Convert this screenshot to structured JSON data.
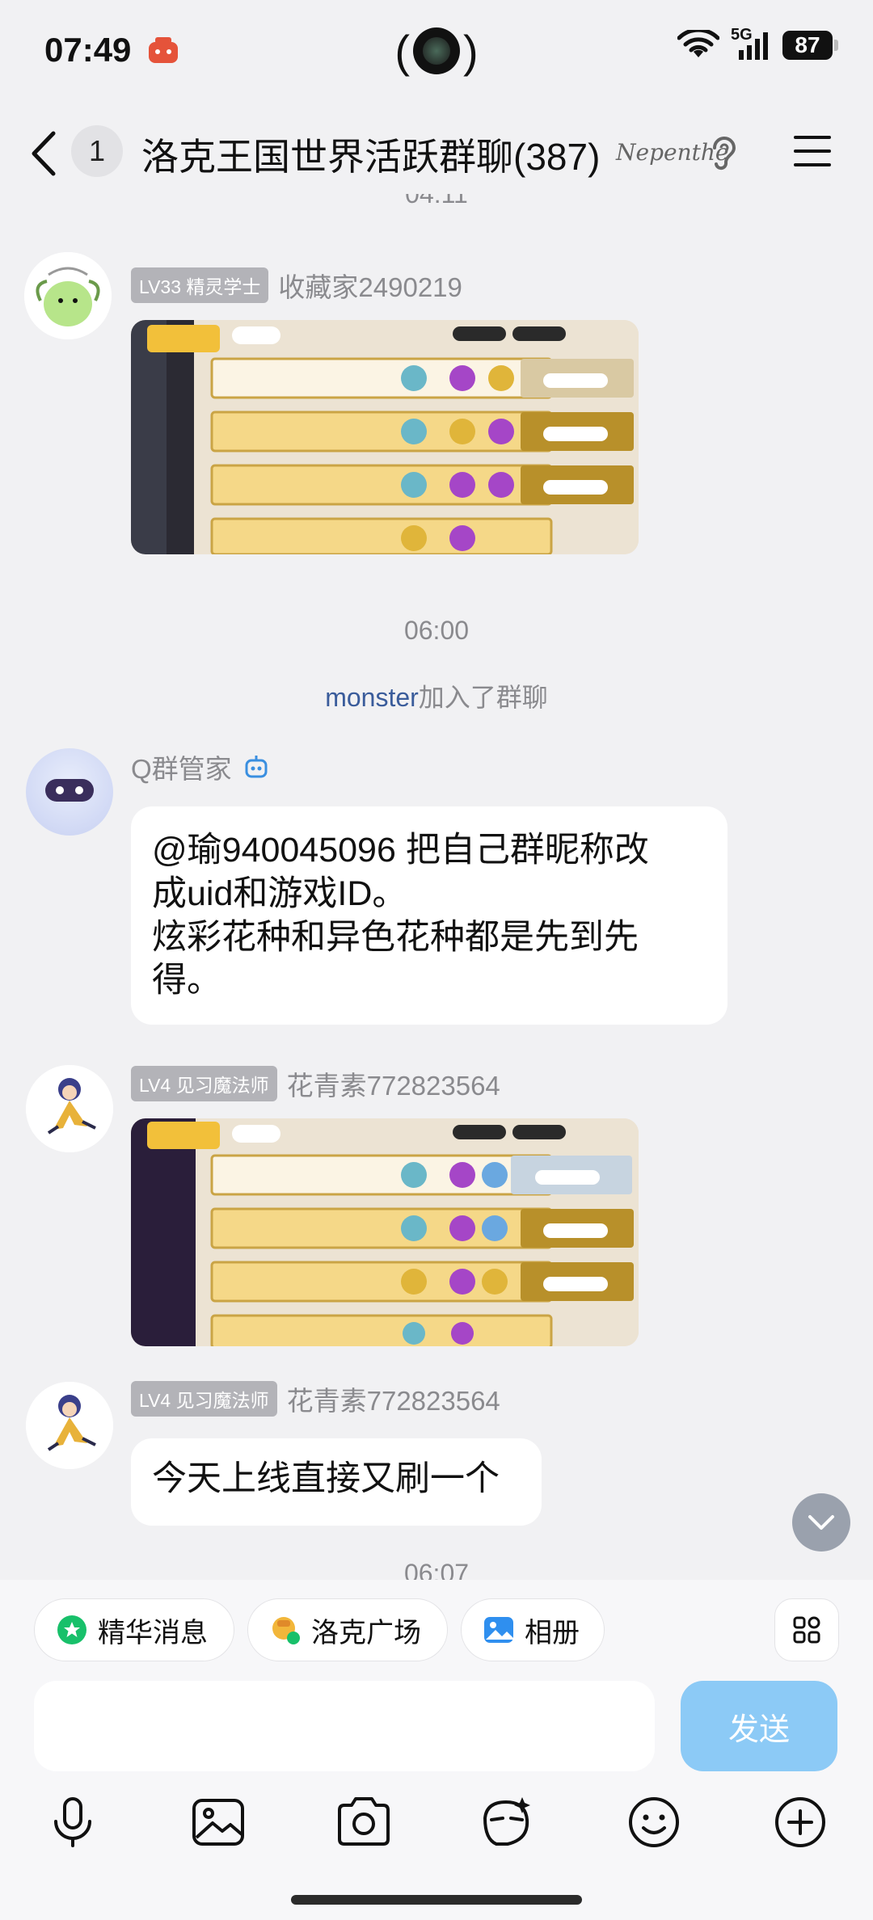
{
  "status_bar": {
    "time": "07:49",
    "battery": "87",
    "network": "5G"
  },
  "header": {
    "unread_count": "1",
    "title": "洛克王国世界活跃群聊(387)",
    "badge_text": "Nepenthe"
  },
  "messages": {
    "top_time_partial": "04:11",
    "msg1": {
      "level": "LV33 精灵学士",
      "sender": "收藏家2490219"
    },
    "time2": "06:00",
    "join_notice": {
      "name": "monster",
      "text": "加入了群聊"
    },
    "msg2": {
      "sender": "Q群管家",
      "text_line1": "@瑜940045096 把自己群昵称改",
      "text_line2": "成uid和游戏ID。",
      "text_line3": "炫彩花种和异色花种都是先到先",
      "text_line4": "得。"
    },
    "msg3": {
      "level": "LV4 见习魔法师",
      "sender": "花青素772823564"
    },
    "msg4": {
      "level": "LV4 见习魔法师",
      "sender": "花青素772823564",
      "text": "今天上线直接又刷一个"
    },
    "bottom_time_partial": "06:07"
  },
  "quick_actions": [
    {
      "label": "精华消息"
    },
    {
      "label": "洛克广场"
    },
    {
      "label": "相册"
    }
  ],
  "input": {
    "placeholder": "",
    "send_label": "发送"
  },
  "colors": {
    "send_button": "#8ccaf6",
    "background": "#f1f1f3",
    "accent_link": "#3a5c9b"
  }
}
